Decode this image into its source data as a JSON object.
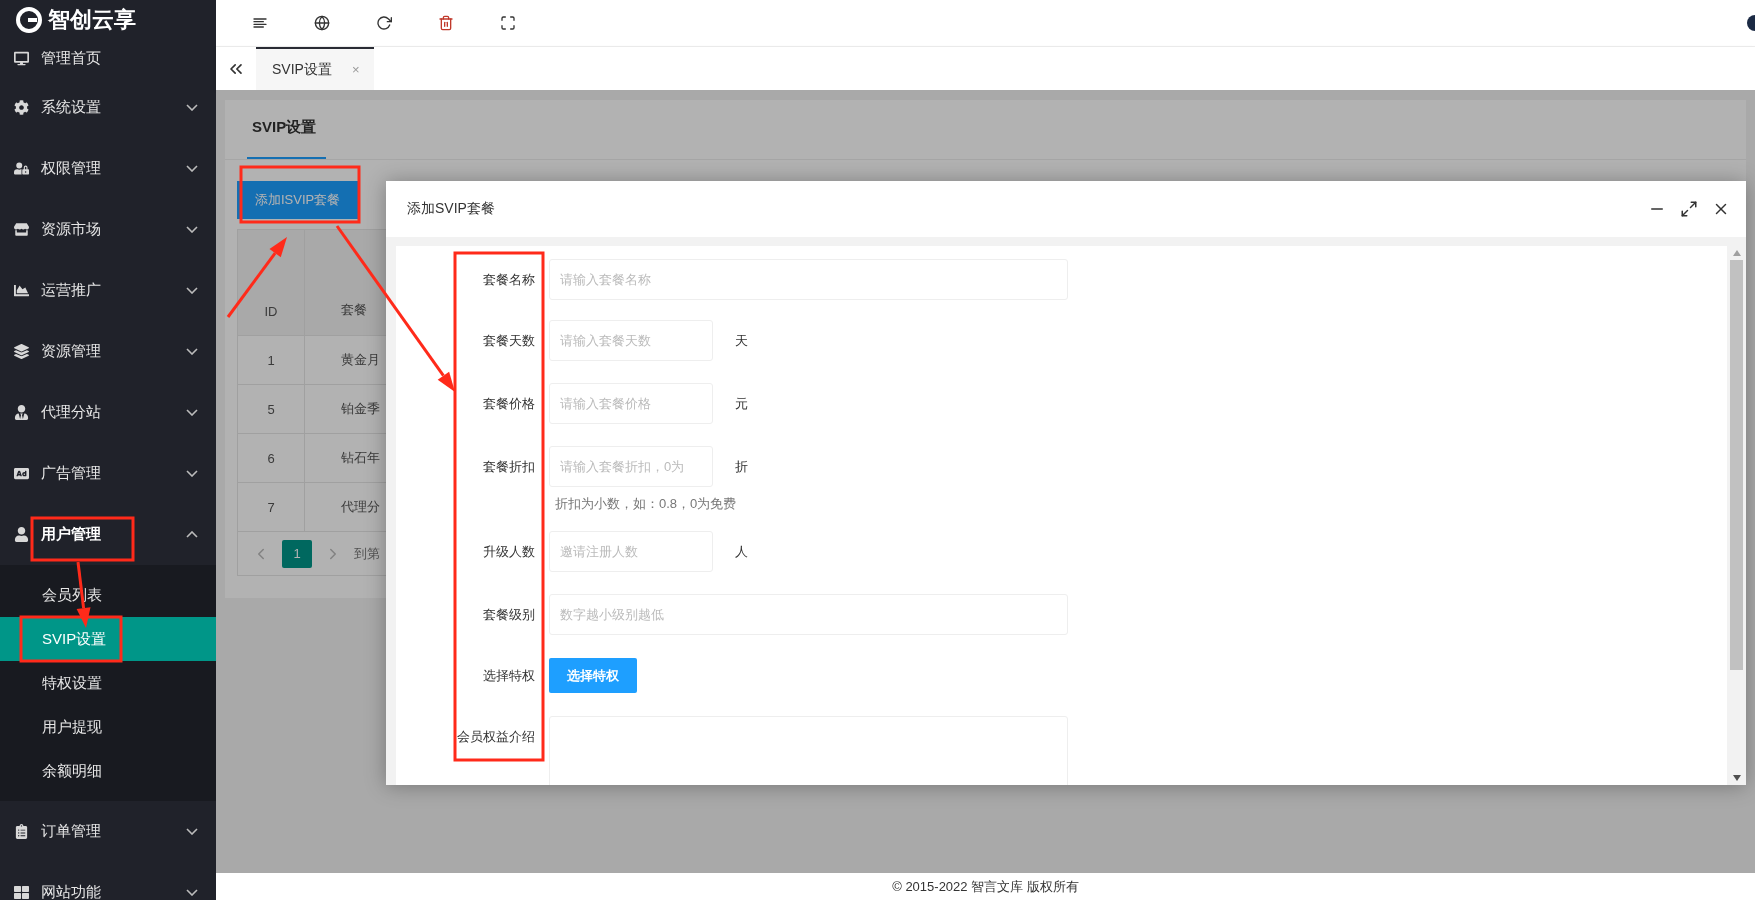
{
  "logo": {
    "text": "智创云享"
  },
  "sidebar": {
    "items": [
      {
        "label": "管理首页"
      },
      {
        "label": "系统设置",
        "expanded": false
      },
      {
        "label": "权限管理",
        "expanded": false
      },
      {
        "label": "资源市场",
        "expanded": false
      },
      {
        "label": "运营推广",
        "expanded": false
      },
      {
        "label": "资源管理",
        "expanded": false
      },
      {
        "label": "代理分站",
        "expanded": false
      },
      {
        "label": "广告管理",
        "expanded": false
      },
      {
        "label": "用户管理",
        "expanded": true,
        "children": [
          {
            "label": "会员列表",
            "selected": false
          },
          {
            "label": "SVIP设置",
            "selected": true
          },
          {
            "label": "特权设置",
            "selected": false
          },
          {
            "label": "用户提现",
            "selected": false
          },
          {
            "label": "余额明细",
            "selected": false
          }
        ]
      },
      {
        "label": "订单管理",
        "expanded": false
      },
      {
        "label": "网站功能",
        "expanded": false
      }
    ]
  },
  "tabs": [
    {
      "label": "SVIP设置",
      "selected": true,
      "close": "×"
    }
  ],
  "page": {
    "title": "SVIP设置",
    "add_button": "添加ISVIP套餐",
    "table": {
      "columns": [
        "ID",
        "套餐"
      ],
      "rows": [
        [
          "1",
          "黄金月"
        ],
        [
          "5",
          "铂金季"
        ],
        [
          "6",
          "钻石年"
        ],
        [
          "7",
          "代理分"
        ]
      ]
    },
    "pagination": {
      "pages": [
        {
          "label": "1",
          "selected": true
        }
      ],
      "goto": "到第"
    }
  },
  "modal": {
    "title": "添加SVIP套餐",
    "fields": [
      {
        "kind": "long",
        "label": "套餐名称",
        "placeholder": "请输入套餐名称"
      },
      {
        "kind": "short",
        "label": "套餐天数",
        "placeholder": "请输入套餐天数",
        "unit": "天"
      },
      {
        "kind": "short",
        "label": "套餐价格",
        "placeholder": "请输入套餐价格",
        "unit": "元"
      },
      {
        "kind": "short",
        "label": "套餐折扣",
        "placeholder": "请输入套餐折扣，0为",
        "unit": "折",
        "hint": "折扣为小数，如：0.8，0为免费"
      },
      {
        "kind": "short",
        "label": "升级人数",
        "placeholder": "邀请注册人数",
        "unit": "人"
      },
      {
        "kind": "long",
        "label": "套餐级别",
        "placeholder": "数字越小级别越低"
      },
      {
        "kind": "button",
        "label": "选择特权",
        "button": "选择特权"
      },
      {
        "kind": "textarea",
        "label": "会员权益介绍"
      }
    ]
  },
  "footer": {
    "text": "© 2015-2022 智言文库 版权所有"
  }
}
